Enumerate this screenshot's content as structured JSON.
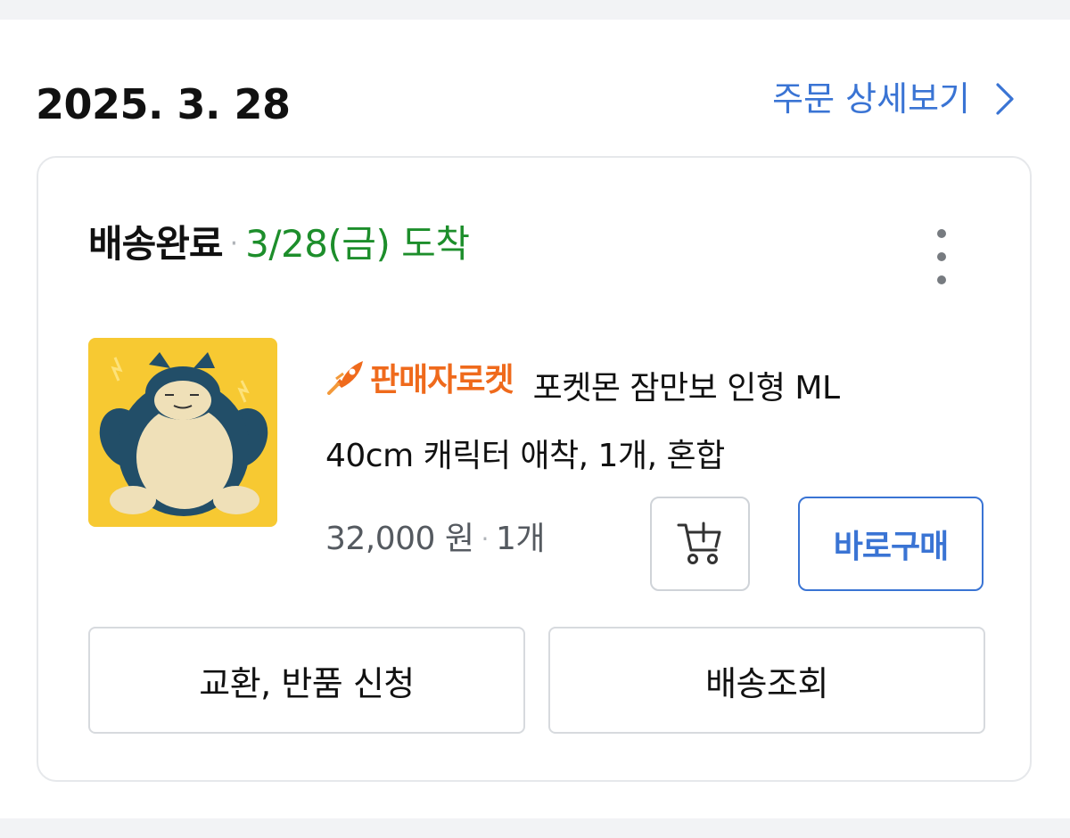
{
  "order": {
    "date": "2025. 3. 28",
    "detail_link_label": "주문 상세보기",
    "chevron_icon": "chevron-right-icon"
  },
  "shipment": {
    "status_label": "배송완료",
    "arrival_text": "3/28(금) 도착",
    "more_icon": "more-vertical-icon"
  },
  "product": {
    "image_icon": "snorlax-plush-thumbnail",
    "badge_icon": "rocket-icon",
    "seller_badge": "판매자로켓",
    "name_line1": "포켓몬 잠만보 인형 ML",
    "name_line2": "40cm 캐릭터 애착, 1개, 혼합",
    "price": "32,000 원",
    "separator": "·",
    "quantity": "1개"
  },
  "actions": {
    "cart_icon": "add-to-cart-icon",
    "buy_now_label": "바로구매",
    "exchange_return_label": "교환, 반품 신청",
    "track_delivery_label": "배송조회"
  },
  "colors": {
    "accent_blue": "#3a74d4",
    "arrival_green": "#1d8e2b",
    "badge_orange": "#ef6a1c",
    "thumbnail_yellow": "#f7c932"
  }
}
